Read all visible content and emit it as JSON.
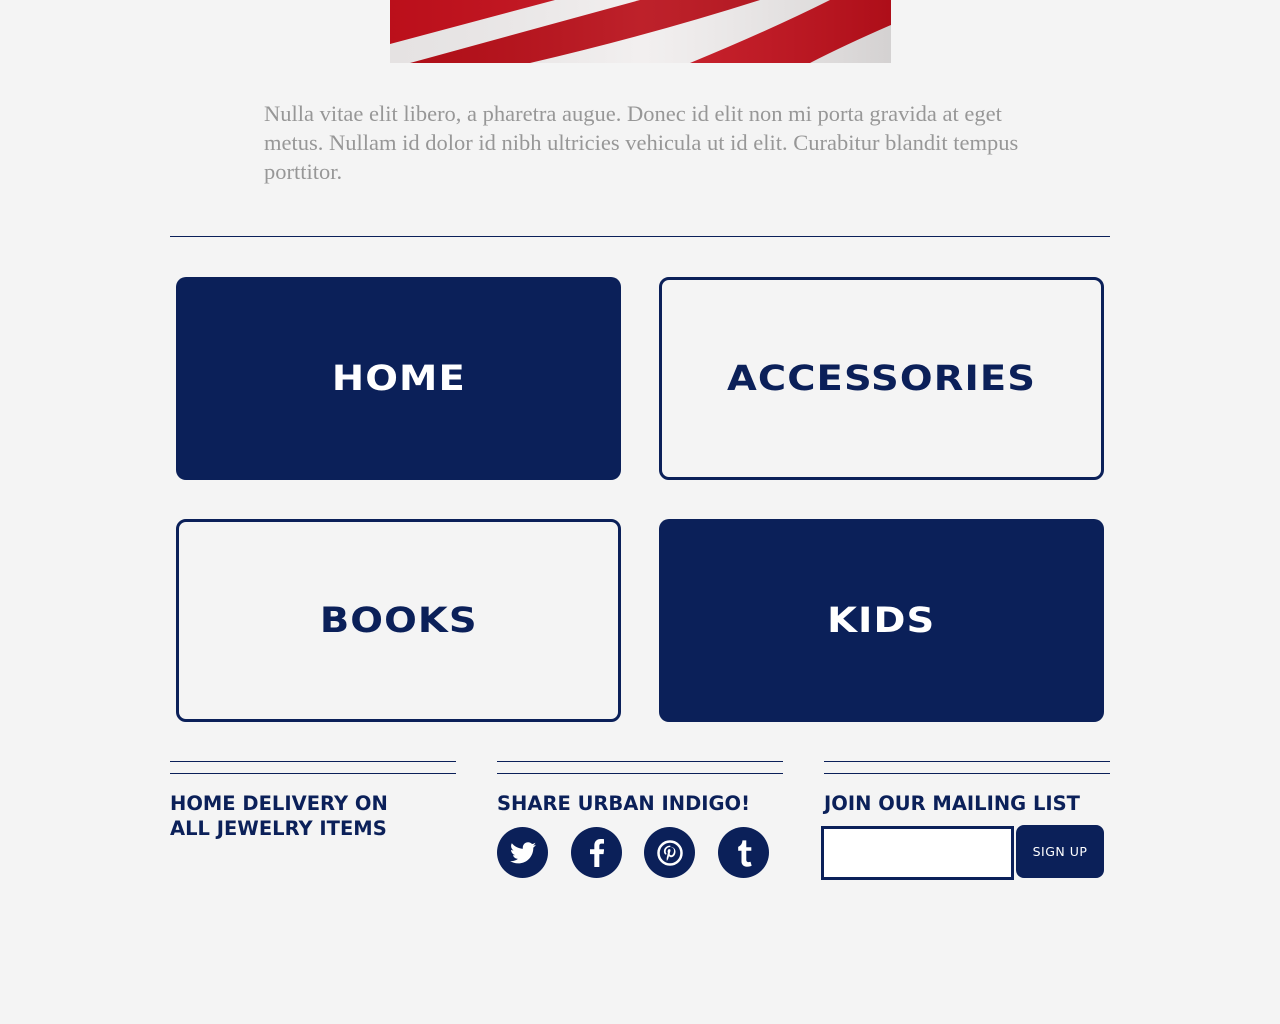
{
  "hero": {
    "image": "american-flag-stripes",
    "colors": {
      "red": "#c5101c",
      "white": "#f1eeee"
    }
  },
  "intro": {
    "text": "Nulla vitae elit libero, a pharetra augue. Donec id elit non mi porta gravida at eget metus. Nullam id dolor id nibh ultricies vehicula ut id elit. Curabitur blandit tempus porttitor."
  },
  "categories": [
    {
      "label": "HOME",
      "style": "solid"
    },
    {
      "label": "ACCESSORIES",
      "style": "outline"
    },
    {
      "label": "BOOKS",
      "style": "outline"
    },
    {
      "label": "KIDS",
      "style": "solid"
    }
  ],
  "footer": {
    "delivery": {
      "line1": "HOME DELIVERY ON",
      "line2": "ALL JEWELRY ITEMS"
    },
    "share": {
      "heading": "SHARE URBAN INDIGO!",
      "icons": [
        "twitter-icon",
        "facebook-icon",
        "pinterest-icon",
        "tumblr-icon"
      ]
    },
    "mailing": {
      "heading": "JOIN OUR MAILING LIST",
      "email_value": "",
      "button_label": "SIGN UP"
    }
  },
  "colors": {
    "navy": "#0b2059",
    "background": "#f4f4f4",
    "body_text": "#979797"
  }
}
